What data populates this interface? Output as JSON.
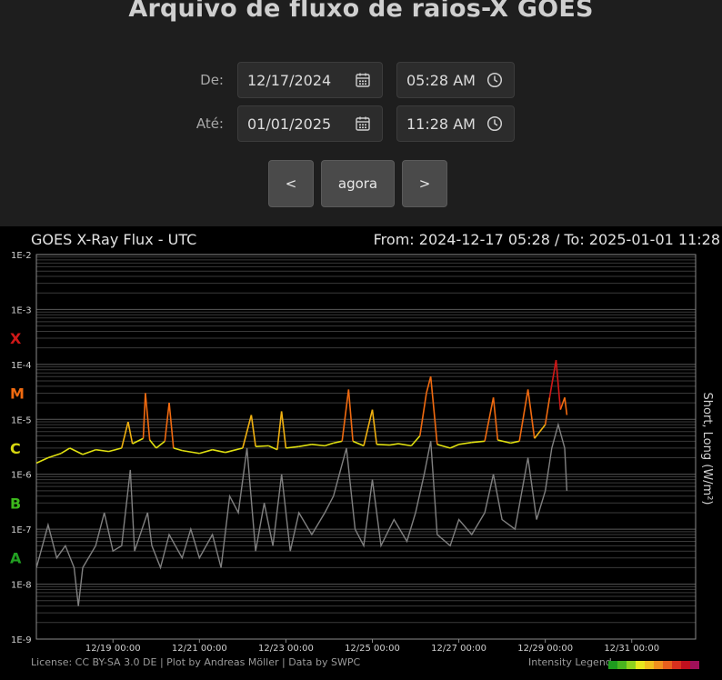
{
  "page": {
    "title": "Arquivo de fluxo de raios-X GOES"
  },
  "form": {
    "from_label": "De:",
    "to_label": "Até:",
    "from_date": "12/17/2024",
    "from_time": "05:28 AM",
    "to_date": "01/01/2025",
    "to_time": "11:28 AM",
    "prev_label": "<",
    "now_label": "agora",
    "next_label": ">"
  },
  "footer": {
    "license": "License: CC BY-SA 3.0 DE | Plot by Andreas Möller | Data by SWPC",
    "legend_label": "Intensity Legend",
    "legend_colors": [
      "#1e9c1e",
      "#49b51e",
      "#8fd21e",
      "#e8e81e",
      "#f0c01e",
      "#f0901e",
      "#e8601e",
      "#d8301e",
      "#c0101e",
      "#a0105a"
    ]
  },
  "chart_data": {
    "type": "line",
    "title": "GOES X-Ray Flux - UTC",
    "range_text": "From: 2024-12-17 05:28  /  To: 2025-01-01 11:28",
    "ylabel": "Short, Long (W/m²)",
    "yscale": "log",
    "ylim": [
      1e-09,
      0.01
    ],
    "y_ticks": [
      "1E-2",
      "1E-3",
      "1E-4",
      "1E-5",
      "1E-6",
      "1E-7",
      "1E-8",
      "1E-9"
    ],
    "flare_classes": [
      {
        "label": "X",
        "color": "#d01818",
        "value": 0.0003
      },
      {
        "label": "M",
        "color": "#f06a10",
        "value": 3e-05
      },
      {
        "label": "C",
        "color": "#d8d810",
        "value": 3e-06
      },
      {
        "label": "B",
        "color": "#3cb81c",
        "value": 3e-07
      },
      {
        "label": "A",
        "color": "#22a022",
        "value": 3e-08
      }
    ],
    "x_ticks": [
      "12/19 00:00",
      "12/21 00:00",
      "12/23 00:00",
      "12/25 00:00",
      "12/27 00:00",
      "12/29 00:00",
      "12/31 00:00"
    ],
    "xlim_days": [
      17.228,
      32.478
    ],
    "series": [
      {
        "name": "Long",
        "color_by_class": true,
        "points": [
          [
            17.23,
            1.6e-06
          ],
          [
            17.5,
            2e-06
          ],
          [
            17.8,
            2.4e-06
          ],
          [
            18.0,
            3e-06
          ],
          [
            18.3,
            2.3e-06
          ],
          [
            18.6,
            2.8e-06
          ],
          [
            18.9,
            2.6e-06
          ],
          [
            19.2,
            3e-06
          ],
          [
            19.35,
            9e-06
          ],
          [
            19.45,
            3.6e-06
          ],
          [
            19.7,
            4.5e-06
          ],
          [
            19.75,
            3e-05
          ],
          [
            19.85,
            4.2e-06
          ],
          [
            20.0,
            3e-06
          ],
          [
            20.2,
            4e-06
          ],
          [
            20.3,
            2e-05
          ],
          [
            20.4,
            3e-06
          ],
          [
            20.6,
            2.7e-06
          ],
          [
            21.0,
            2.4e-06
          ],
          [
            21.3,
            2.8e-06
          ],
          [
            21.6,
            2.5e-06
          ],
          [
            22.0,
            3e-06
          ],
          [
            22.2,
            1.2e-05
          ],
          [
            22.3,
            3.2e-06
          ],
          [
            22.6,
            3.3e-06
          ],
          [
            22.8,
            2.8e-06
          ],
          [
            22.9,
            1.4e-05
          ],
          [
            23.0,
            3e-06
          ],
          [
            23.3,
            3.2e-06
          ],
          [
            23.6,
            3.5e-06
          ],
          [
            23.9,
            3.3e-06
          ],
          [
            24.1,
            3.7e-06
          ],
          [
            24.3,
            4e-06
          ],
          [
            24.45,
            3.5e-05
          ],
          [
            24.55,
            4e-06
          ],
          [
            24.8,
            3.3e-06
          ],
          [
            25.0,
            1.5e-05
          ],
          [
            25.1,
            3.5e-06
          ],
          [
            25.4,
            3.4e-06
          ],
          [
            25.6,
            3.6e-06
          ],
          [
            25.9,
            3.3e-06
          ],
          [
            26.1,
            5e-06
          ],
          [
            26.25,
            3e-05
          ],
          [
            26.35,
            6e-05
          ],
          [
            26.5,
            3.5e-06
          ],
          [
            26.8,
            3e-06
          ],
          [
            27.0,
            3.5e-06
          ],
          [
            27.3,
            3.8e-06
          ],
          [
            27.6,
            4e-06
          ],
          [
            27.8,
            2.5e-05
          ],
          [
            27.9,
            4.2e-06
          ],
          [
            28.2,
            3.7e-06
          ],
          [
            28.4,
            4e-06
          ],
          [
            28.6,
            3.5e-05
          ],
          [
            28.75,
            4.5e-06
          ],
          [
            29.0,
            8e-06
          ],
          [
            29.1,
            2.5e-05
          ],
          [
            29.25,
            0.00012
          ],
          [
            29.35,
            1.5e-05
          ],
          [
            29.45,
            2.5e-05
          ],
          [
            29.5,
            1.2e-05
          ]
        ]
      },
      {
        "name": "Short",
        "color": "#808080",
        "points": [
          [
            17.23,
            2e-08
          ],
          [
            17.5,
            1.2e-07
          ],
          [
            17.7,
            3e-08
          ],
          [
            17.9,
            5e-08
          ],
          [
            18.1,
            2e-08
          ],
          [
            18.2,
            4e-09
          ],
          [
            18.3,
            2e-08
          ],
          [
            18.6,
            5e-08
          ],
          [
            18.8,
            2e-07
          ],
          [
            19.0,
            4e-08
          ],
          [
            19.2,
            5e-08
          ],
          [
            19.4,
            1.2e-06
          ],
          [
            19.5,
            4e-08
          ],
          [
            19.8,
            2e-07
          ],
          [
            19.9,
            5e-08
          ],
          [
            20.1,
            2e-08
          ],
          [
            20.3,
            8e-08
          ],
          [
            20.6,
            3e-08
          ],
          [
            20.8,
            1e-07
          ],
          [
            21.0,
            3e-08
          ],
          [
            21.3,
            8e-08
          ],
          [
            21.5,
            2e-08
          ],
          [
            21.7,
            4e-07
          ],
          [
            21.9,
            2e-07
          ],
          [
            22.1,
            3e-06
          ],
          [
            22.3,
            4e-08
          ],
          [
            22.5,
            3e-07
          ],
          [
            22.7,
            5e-08
          ],
          [
            22.9,
            1e-06
          ],
          [
            23.1,
            4e-08
          ],
          [
            23.3,
            2e-07
          ],
          [
            23.6,
            8e-08
          ],
          [
            23.9,
            2e-07
          ],
          [
            24.1,
            4e-07
          ],
          [
            24.4,
            3e-06
          ],
          [
            24.6,
            1e-07
          ],
          [
            24.8,
            5e-08
          ],
          [
            25.0,
            8e-07
          ],
          [
            25.2,
            5e-08
          ],
          [
            25.5,
            1.5e-07
          ],
          [
            25.8,
            6e-08
          ],
          [
            26.0,
            2e-07
          ],
          [
            26.2,
            1e-06
          ],
          [
            26.35,
            4e-06
          ],
          [
            26.5,
            8e-08
          ],
          [
            26.8,
            5e-08
          ],
          [
            27.0,
            1.5e-07
          ],
          [
            27.3,
            8e-08
          ],
          [
            27.6,
            2e-07
          ],
          [
            27.8,
            1e-06
          ],
          [
            28.0,
            1.5e-07
          ],
          [
            28.3,
            1e-07
          ],
          [
            28.6,
            2e-06
          ],
          [
            28.8,
            1.5e-07
          ],
          [
            29.0,
            5e-07
          ],
          [
            29.15,
            3e-06
          ],
          [
            29.3,
            8e-06
          ],
          [
            29.45,
            3e-06
          ],
          [
            29.5,
            5e-07
          ]
        ]
      }
    ]
  }
}
